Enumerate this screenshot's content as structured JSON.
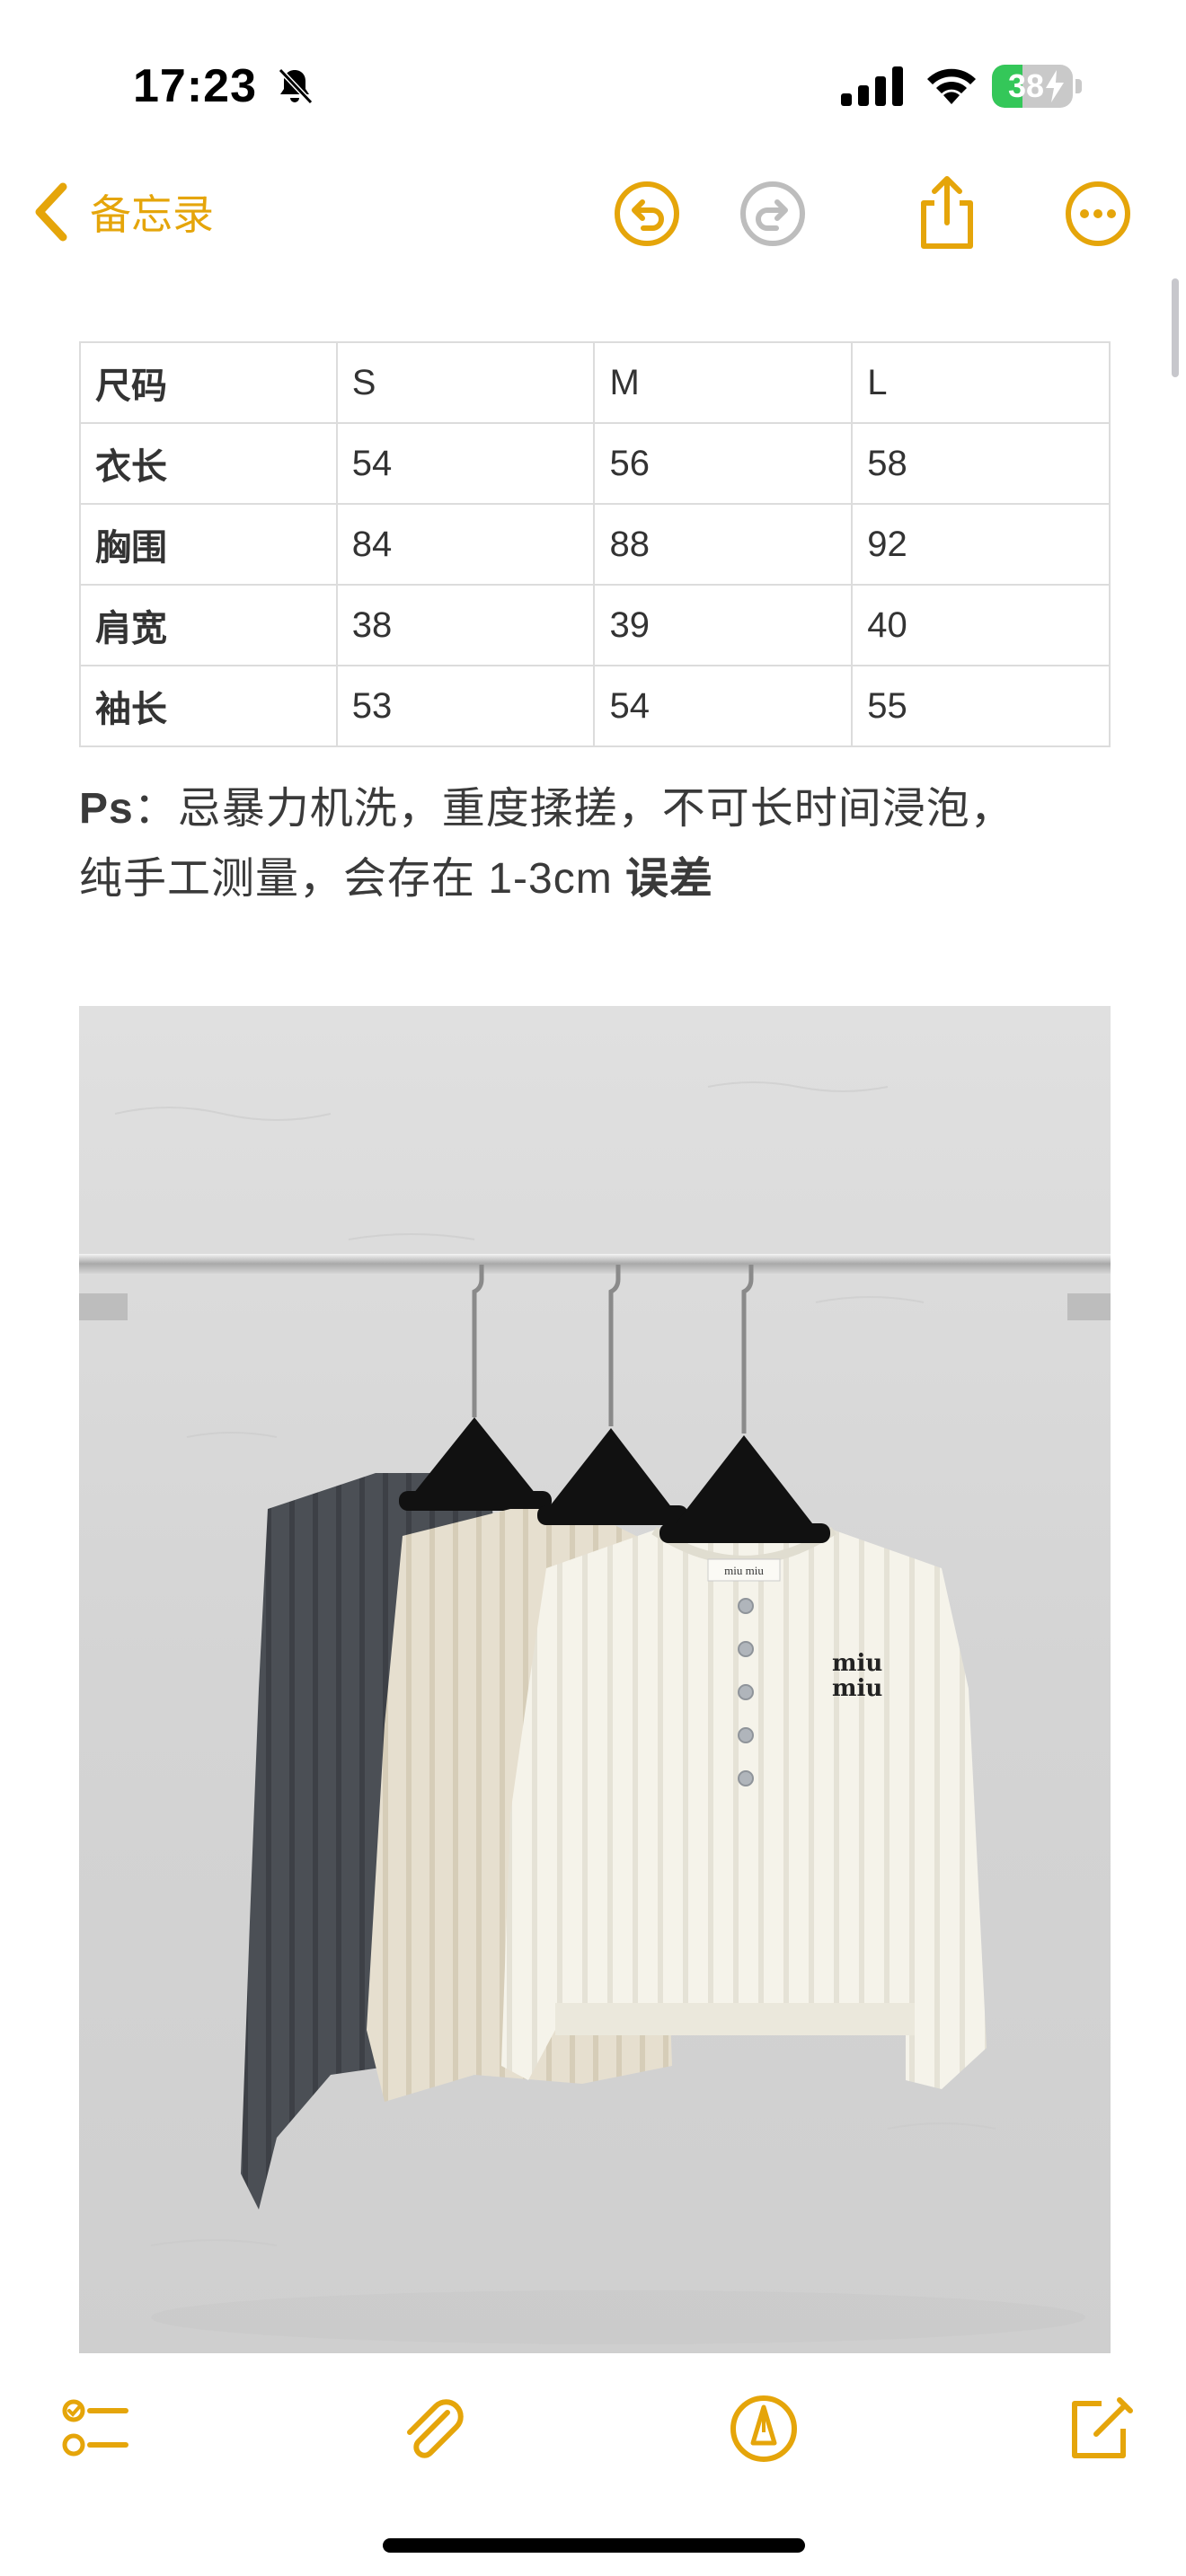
{
  "status_bar": {
    "time": "17:23",
    "battery_level": "38",
    "battery_fraction": 0.38,
    "icons": [
      "bell-off-icon",
      "cellular-signal-icon",
      "wifi-icon",
      "battery-charging-icon"
    ]
  },
  "nav": {
    "back_label": "备忘录",
    "icons": [
      "chevron-left-icon",
      "undo-icon",
      "redo-icon",
      "share-icon",
      "more-icon"
    ]
  },
  "table": {
    "rows": [
      [
        "尺码",
        "S",
        "M",
        "L"
      ],
      [
        "衣长",
        "54",
        "56",
        "58"
      ],
      [
        "胸围",
        "84",
        "88",
        "92"
      ],
      [
        "肩宽",
        "38",
        "39",
        "40"
      ],
      [
        "袖长",
        "53",
        "54",
        "55"
      ]
    ]
  },
  "note": {
    "prefix": "Ps",
    "line1_rest": "：忌暴力机洗，重度揉搓，不可长时间浸泡，",
    "line2_main": "纯手工测量，会存在 1-3cm ",
    "line2_bold": "误差"
  },
  "photo": {
    "logo_top": "miu miu",
    "logo_chest_line1": "miu",
    "logo_chest_line2": "miu"
  },
  "colors": {
    "accent": "#e5a50a",
    "battery_green": "#34c759",
    "redo_disabled": "#bdbdbd"
  },
  "toolbar": {
    "icons": [
      "checklist-icon",
      "attachment-icon",
      "markup-icon",
      "compose-icon"
    ]
  }
}
